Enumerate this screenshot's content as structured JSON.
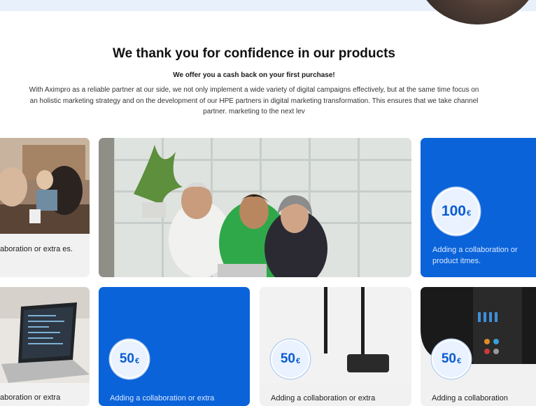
{
  "header": {
    "title": "We thank you for confidence in our products",
    "subtitle": "We offer you a cash back on your first purchase!",
    "description": "With Aximpro as a reliable partner at our side, we not only implement a wide variety of digital campaigns effectively, but at the same time focus on an holistic marketing strategy and on the development of our HPE partners in digital marketing transformation. This ensures that we take channel partner. marketing to the next lev"
  },
  "cards": {
    "c1": {
      "text": "aboration or extra es."
    },
    "c2": {
      "text": ""
    },
    "c3": {
      "amount": "100",
      "currency": "€",
      "text": "Adding a collaboration or product itmes."
    },
    "c4": {
      "text": "aboration or extra"
    },
    "c5": {
      "amount": "50",
      "currency": "€",
      "text": "Adding a collaboration or extra"
    },
    "c6": {
      "amount": "50",
      "currency": "€",
      "text": "Adding a collaboration or extra"
    },
    "c7": {
      "amount": "50",
      "currency": "€",
      "text": "Adding a collaboration"
    }
  },
  "colors": {
    "accent": "#0a63d9",
    "band": "#e7f0fb"
  }
}
